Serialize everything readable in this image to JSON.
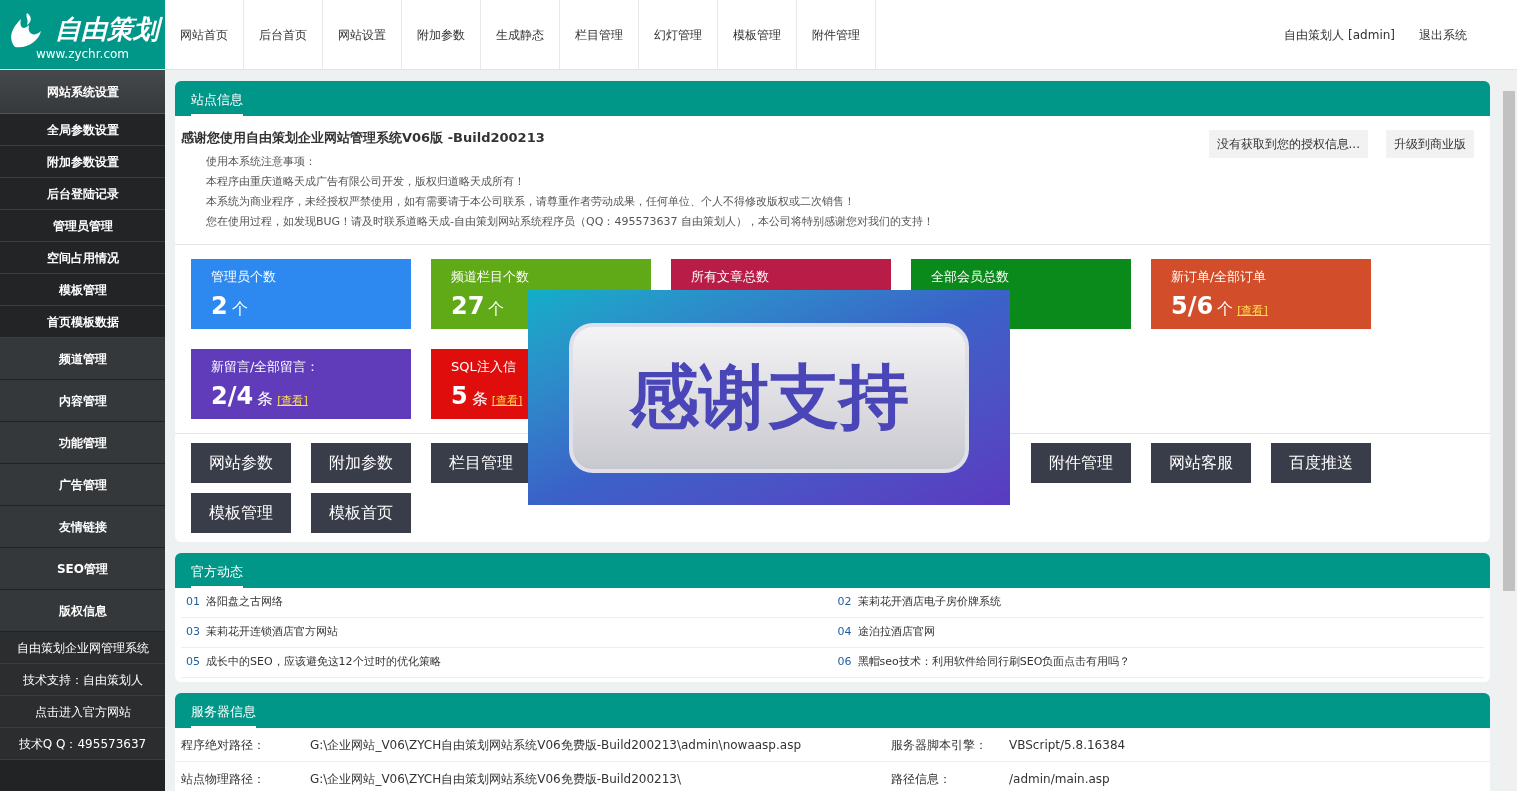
{
  "logo": {
    "text": "自由策划",
    "url": "www.zychr.com"
  },
  "nav": [
    "网站首页",
    "后台首页",
    "网站设置",
    "附加参数",
    "生成静态",
    "栏目管理",
    "幻灯管理",
    "模板管理",
    "附件管理"
  ],
  "user": {
    "name": "自由策划人 [admin]",
    "logout": "退出系统"
  },
  "sidebar": {
    "header": "网站系统设置",
    "sub_items": [
      "全局参数设置",
      "附加参数设置",
      "后台登陆记录",
      "管理员管理",
      "空间占用情况",
      "模板管理",
      "首页模板数据"
    ],
    "groups": [
      "频道管理",
      "内容管理",
      "功能管理",
      "广告管理",
      "友情链接",
      "SEO管理",
      "版权信息"
    ],
    "footer": [
      "自由策划企业网管理系统",
      "技术支持：自由策划人",
      "点击进入官方网站",
      "技术Q Q：495573637"
    ]
  },
  "site_info": {
    "title": "站点信息",
    "heading": "感谢您使用自由策划企业网站管理系统V06版 -Build200213",
    "buttons": [
      "没有获取到您的授权信息...",
      "升级到商业版"
    ],
    "notes": [
      "使用本系统注意事项：",
      "本程序由重庆道略天成广告有限公司开发，版权归道略天成所有！",
      "本系统为商业程序，未经授权严禁使用，如有需要请于本公司联系，请尊重作者劳动成果，任何单位、个人不得修改版权或二次销售！",
      "您在使用过程，如发现BUG！请及时联系道略天成-自由策划网站系统程序员（QQ：495573637 自由策划人），本公司将特别感谢您对我们的支持！"
    ],
    "cards": [
      {
        "title": "管理员个数",
        "value": "2",
        "unit": "个",
        "color": "#2d89ef"
      },
      {
        "title": "频道栏目个数",
        "value": "27",
        "unit": "个",
        "color": "#60a917"
      },
      {
        "title": "所有文章总数",
        "color": "#b91d47"
      },
      {
        "title": "全部会员总数",
        "color": "#0a8a1a"
      },
      {
        "title": "新订单/全部订单",
        "value": "5/6",
        "unit": "个",
        "link": "[查看]",
        "color": "#d24e2a"
      },
      {
        "title": "新留言/全部留言：",
        "value": "2/4",
        "unit": "条",
        "link": "[查看]",
        "color": "#603cba"
      },
      {
        "title": "SQL注入信",
        "value": "5",
        "unit": "条",
        "link": "[查看]",
        "color": "#e00d0d"
      }
    ],
    "quick_buttons": [
      [
        [
          "网站参数",
          "附加参数",
          "栏目管理"
        ],
        [
          "附件管理",
          "网站客服",
          "百度推送"
        ]
      ],
      [
        [
          "模板管理",
          "模板首页"
        ]
      ]
    ]
  },
  "overlay": {
    "text": "感谢支持"
  },
  "news": {
    "title": "官方动态",
    "items": [
      {
        "num": "01",
        "text": "洛阳盘之古网络"
      },
      {
        "num": "02",
        "text": "茉莉花开酒店电子房价牌系统"
      },
      {
        "num": "03",
        "text": "茉莉花开连锁酒店官方网站"
      },
      {
        "num": "04",
        "text": "途泊拉酒店官网"
      },
      {
        "num": "05",
        "text": "成长中的SEO，应该避免这12个过时的优化策略"
      },
      {
        "num": "06",
        "text": "黑帽seo技术：利用软件给同行刷SEO负面点击有用吗？"
      }
    ]
  },
  "server": {
    "title": "服务器信息",
    "rows": [
      [
        "程序绝对路径：",
        "G:\\企业网站_V06\\ZYCH自由策划网站系统V06免费版-Build200213\\admin\\nowaasp.asp",
        "服务器脚本引擎：",
        "VBScript/5.8.16384"
      ],
      [
        "站点物理路径：",
        "G:\\企业网站_V06\\ZYCH自由策划网站系统V06免费版-Build200213\\",
        "路径信息：",
        "/admin/main.asp"
      ]
    ]
  }
}
